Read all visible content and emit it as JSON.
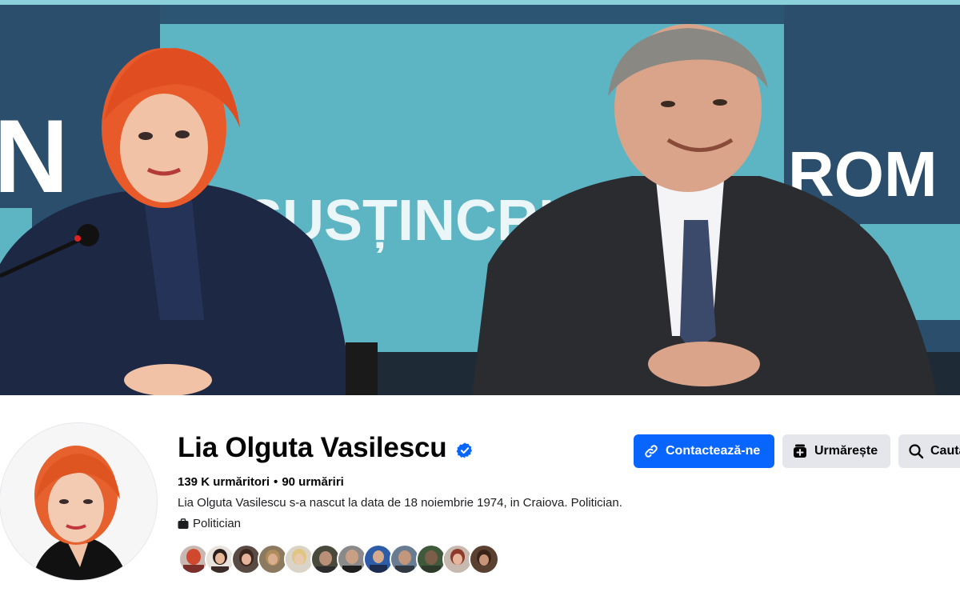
{
  "profile": {
    "name": "Lia Olguta Vasilescu",
    "verified": true,
    "followers": "139 K urmăritori",
    "following": "90 urmăriri",
    "separator": "•",
    "bio": "Lia Olguta Vasilescu s-a nascut la data de 18 noiembrie 1974, in Craiova. Politician.",
    "category": "Politician"
  },
  "cover": {
    "banner_text_center": "SUSȚINCRIȘ",
    "banner_text_left": "N",
    "banner_text_right": "ROM"
  },
  "actions": {
    "contact_label": "Contactează-ne",
    "follow_label": "Urmărește",
    "search_label": "Caută"
  },
  "colors": {
    "accent": "#0866ff",
    "secondary_button": "#e4e6eb",
    "verified_badge": "#0866ff",
    "banner_teal": "#5fb7c6",
    "banner_navy": "#1f3b5c"
  },
  "icons": {
    "verified": "verified-badge-icon",
    "category": "briefcase-icon",
    "contact": "link-icon",
    "follow": "follow-icon",
    "search": "search-icon"
  },
  "follower_avatars_count_visible": 12
}
